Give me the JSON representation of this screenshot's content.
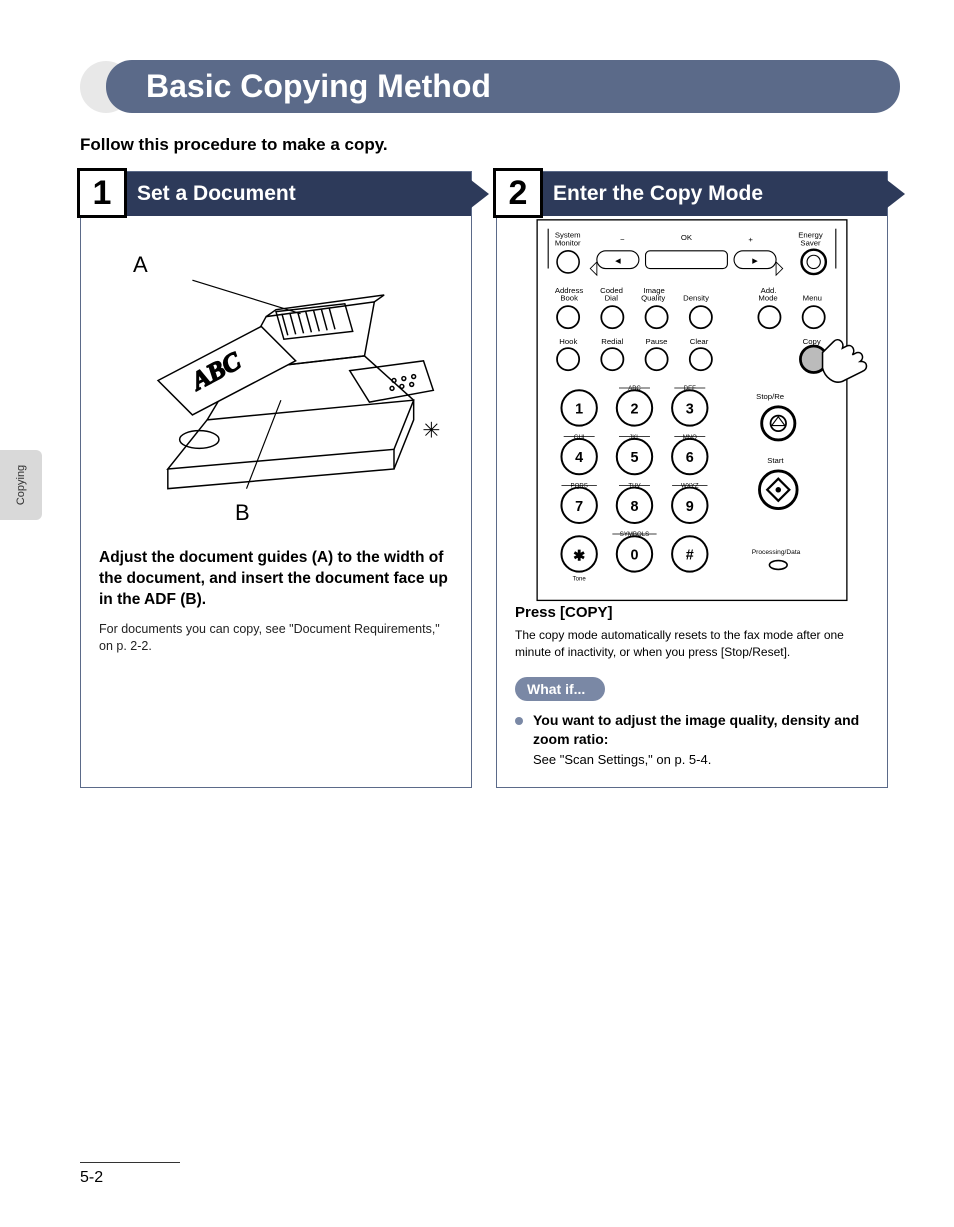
{
  "side_tab": "Copying",
  "title": "Basic Copying Method",
  "intro": "Follow this procedure to make a copy.",
  "step1": {
    "num": "1",
    "title": "Set a Document",
    "label_a": "A",
    "label_b": "B",
    "instruction": "Adjust the document guides (A) to the width of the document, and insert the document face up in the ADF (B).",
    "note": "For documents you can copy, see \"Document Requirements,\" on p. 2-2."
  },
  "step2": {
    "num": "2",
    "title": "Enter the Copy Mode",
    "press_head": "Press [COPY]",
    "press_note": "The copy mode automatically resets to the fax mode after one minute of inactivity, or when you press [Stop/Reset].",
    "whatif_label": "What if...",
    "whatif_q": "You want to adjust the image quality, density and zoom ratio:",
    "whatif_a": "See \"Scan Settings,\" on p. 5-4."
  },
  "panel": {
    "top": {
      "system_monitor": "System\nMonitor",
      "minus": "−",
      "ok": "OK",
      "plus": "+",
      "energy_saver": "Energy\nSaver"
    },
    "row2": {
      "address_book": "Address\nBook",
      "coded_dial": "Coded\nDial",
      "image_quality": "Image\nQuality",
      "density": "Density",
      "add_mode": "Add.\nMode",
      "menu": "Menu"
    },
    "row3": {
      "hook": "Hook",
      "redial": "Redial",
      "pause": "Pause",
      "clear": "Clear",
      "copy": "Copy"
    },
    "right": {
      "stop": "Stop/Re",
      "start": "Start",
      "processing": "Processing/Data"
    },
    "keys": {
      "1": "1",
      "2": "2",
      "3": "3",
      "4": "4",
      "5": "5",
      "6": "6",
      "7": "7",
      "8": "8",
      "9": "9",
      "0": "0",
      "star": "✱",
      "hash": "#",
      "abc": "ABC",
      "def": "DEF",
      "ghi": "GHI",
      "jkl": "JKL",
      "mno": "MNO",
      "pqrs": "PQRS",
      "tuv": "TUV",
      "wxyz": "WXYZ",
      "tone": "Tone",
      "symbols": "SYMBOLS"
    }
  },
  "page_number": "5-2"
}
